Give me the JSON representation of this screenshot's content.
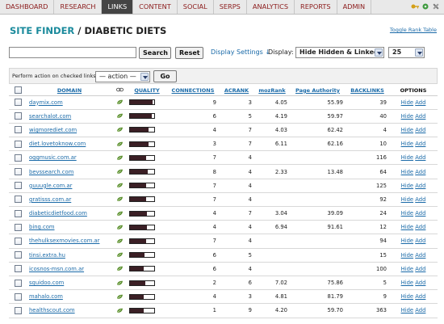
{
  "nav": {
    "items": [
      "DASHBOARD",
      "RESEARCH",
      "LINKS",
      "CONTENT",
      "SOCIAL",
      "SERPS",
      "ANALYTICS",
      "REPORTS",
      "ADMIN"
    ],
    "active": "LINKS",
    "icons": [
      "key-icon",
      "gear-icon",
      "tools-icon"
    ]
  },
  "title": {
    "site": "SITE FINDER",
    "sep": " / ",
    "name": "DIABETIC DIETS"
  },
  "toggle_rank_table": "Toggle Rank Table",
  "search": {
    "value": "",
    "search_label": "Search",
    "reset_label": "Reset",
    "display_settings_label": "Display Settings ↓",
    "display_label": "Display:",
    "display_value": "Hide Hidden & Linked",
    "per_page_value": "25"
  },
  "action": {
    "label": "Perform action on checked links:",
    "select_value": "— action —",
    "go_label": "Go"
  },
  "table": {
    "headers": {
      "domain": "DOMAIN",
      "quality": "QUALITY",
      "connections": "CONNECTIONS",
      "acrank": "ACRANK",
      "mozrank": "mozRank",
      "page_authority": "Page Authority",
      "backlinks": "BACKLINKS",
      "options": "OPTIONS"
    },
    "rows": [
      {
        "domain": "daymix.com",
        "quality": 0.92,
        "connections": "9",
        "acrank": "3",
        "mozrank": "4.05",
        "page_authority": "55.99",
        "backlinks": "39",
        "hide": "Hide",
        "add": "Add"
      },
      {
        "domain": "searchalot.com",
        "quality": 0.9,
        "connections": "6",
        "acrank": "5",
        "mozrank": "4.19",
        "page_authority": "59.97",
        "backlinks": "40",
        "hide": "Hide",
        "add": "Add"
      },
      {
        "domain": "wigmorediet.com",
        "quality": 0.78,
        "connections": "4",
        "acrank": "7",
        "mozrank": "4.03",
        "page_authority": "62.42",
        "backlinks": "4",
        "hide": "Hide",
        "add": "Add"
      },
      {
        "domain": "diet.lovetoknow.com",
        "quality": 0.75,
        "connections": "3",
        "acrank": "7",
        "mozrank": "6.11",
        "page_authority": "62.16",
        "backlinks": "10",
        "hide": "Hide",
        "add": "Add"
      },
      {
        "domain": "oggmusic.com.ar",
        "quality": 0.66,
        "connections": "7",
        "acrank": "4",
        "mozrank": "",
        "page_authority": "",
        "backlinks": "116",
        "hide": "Hide",
        "add": "Add"
      },
      {
        "domain": "bevssearch.com",
        "quality": 0.72,
        "connections": "8",
        "acrank": "4",
        "mozrank": "2.33",
        "page_authority": "13.48",
        "backlinks": "64",
        "hide": "Hide",
        "add": "Add"
      },
      {
        "domain": "guuugle.com.ar",
        "quality": 0.66,
        "connections": "7",
        "acrank": "4",
        "mozrank": "",
        "page_authority": "",
        "backlinks": "125",
        "hide": "Hide",
        "add": "Add"
      },
      {
        "domain": "gratisss.com.ar",
        "quality": 0.66,
        "connections": "7",
        "acrank": "4",
        "mozrank": "",
        "page_authority": "",
        "backlinks": "92",
        "hide": "Hide",
        "add": "Add"
      },
      {
        "domain": "diabeticdietfood.com",
        "quality": 0.7,
        "connections": "4",
        "acrank": "7",
        "mozrank": "3.04",
        "page_authority": "39.09",
        "backlinks": "24",
        "hide": "Hide",
        "add": "Add"
      },
      {
        "domain": "bing.com",
        "quality": 0.69,
        "connections": "4",
        "acrank": "4",
        "mozrank": "6.94",
        "page_authority": "91.61",
        "backlinks": "12",
        "hide": "Hide",
        "add": "Add"
      },
      {
        "domain": "thehulksexmovies.com.ar",
        "quality": 0.66,
        "connections": "7",
        "acrank": "4",
        "mozrank": "",
        "page_authority": "",
        "backlinks": "94",
        "hide": "Hide",
        "add": "Add"
      },
      {
        "domain": "tinsi.extra.hu",
        "quality": 0.6,
        "connections": "6",
        "acrank": "5",
        "mozrank": "",
        "page_authority": "",
        "backlinks": "15",
        "hide": "Hide",
        "add": "Add"
      },
      {
        "domain": "icosnos-msn.com.ar",
        "quality": 0.58,
        "connections": "6",
        "acrank": "4",
        "mozrank": "",
        "page_authority": "",
        "backlinks": "100",
        "hide": "Hide",
        "add": "Add"
      },
      {
        "domain": "squidoo.com",
        "quality": 0.62,
        "connections": "2",
        "acrank": "6",
        "mozrank": "7.02",
        "page_authority": "75.86",
        "backlinks": "5",
        "hide": "Hide",
        "add": "Add"
      },
      {
        "domain": "mahalo.com",
        "quality": 0.57,
        "connections": "4",
        "acrank": "3",
        "mozrank": "4.81",
        "page_authority": "81.79",
        "backlinks": "9",
        "hide": "Hide",
        "add": "Add"
      },
      {
        "domain": "healthscout.com",
        "quality": 0.55,
        "connections": "1",
        "acrank": "9",
        "mozrank": "4.20",
        "page_authority": "59.70",
        "backlinks": "363",
        "hide": "Hide",
        "add": "Add"
      }
    ]
  },
  "colors": {
    "nav_text": "#8b1a1a",
    "nav_active_bg": "#444444",
    "accent": "#1a8a9c",
    "link": "#1a6aa8",
    "quality_fill": "#3b1f25",
    "leaf_icon": "#5a8f2e"
  }
}
